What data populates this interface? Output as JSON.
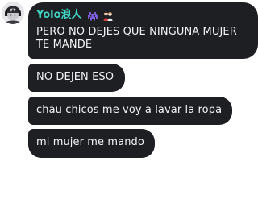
{
  "chat": {
    "username": "Yolo浪人",
    "username_color": "#41d2c2",
    "bubble_color": "#1e1f22",
    "badges": [
      {
        "icon": "space-invader-icon"
      },
      {
        "icon": "people-icon"
      }
    ],
    "messages": [
      {
        "text": "PERO NO DEJES QUE NINGUNA MUJER\nTE MANDE"
      },
      {
        "text": "NO DEJEN ESO"
      },
      {
        "text": "chau chicos me voy a lavar la ropa"
      },
      {
        "text": "mi mujer me mando"
      }
    ]
  }
}
